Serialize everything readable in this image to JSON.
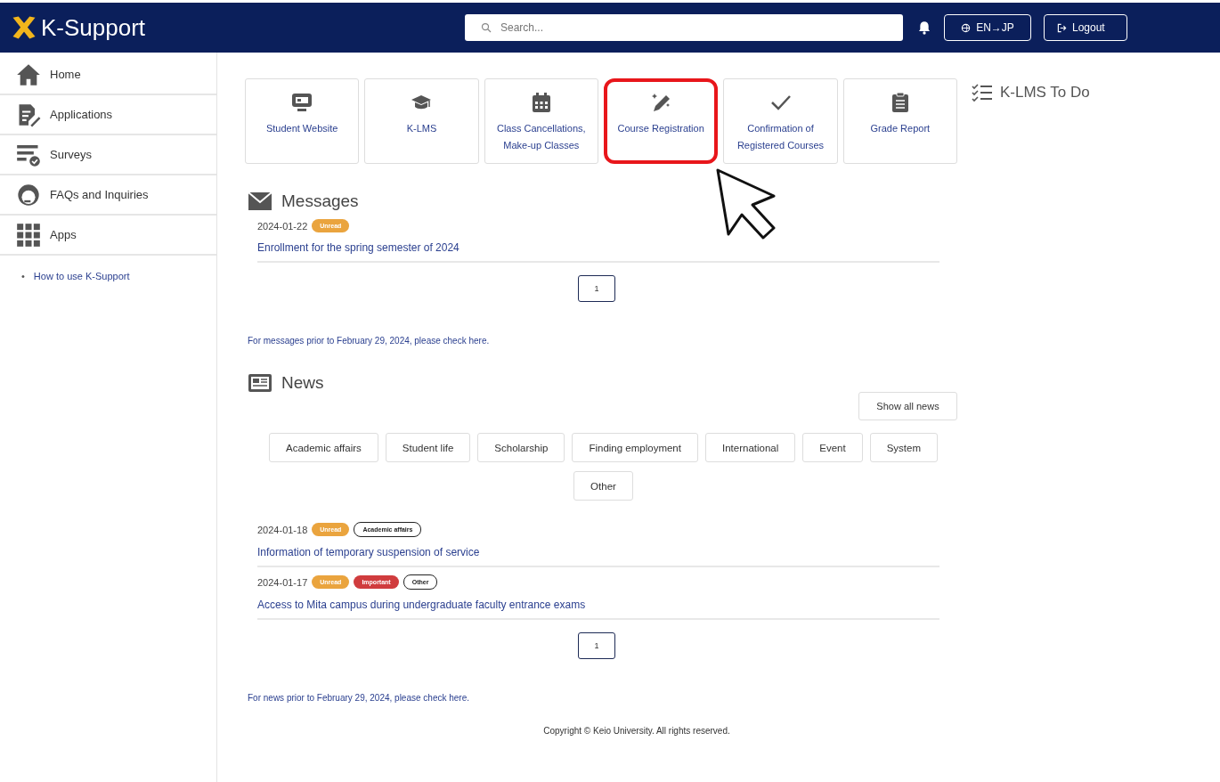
{
  "header": {
    "logo": "K-Support",
    "search": {
      "placeholder": "Search..."
    },
    "buttons": [
      {
        "kind": "language",
        "label": "EN→JP"
      },
      {
        "kind": "logout",
        "label": "Logout"
      }
    ]
  },
  "sidebar": {
    "items": [
      {
        "kind": "home",
        "label": "Home"
      },
      {
        "kind": "applications",
        "label": "Applications"
      },
      {
        "kind": "surveys",
        "label": "Surveys"
      },
      {
        "kind": "faq",
        "label": "FAQs and Inquiries"
      },
      {
        "kind": "apps",
        "label": "Apps"
      }
    ],
    "links": [
      {
        "bullet": "•",
        "label": "How to use K-Support"
      }
    ]
  },
  "shortcuts": [
    {
      "kind": "website",
      "label": "Student Website",
      "highlighted": false
    },
    {
      "kind": "lms",
      "label": "K-LMS",
      "highlighted": false
    },
    {
      "kind": "calendar",
      "label": "Class Cancellations, Make-up Classes",
      "highlighted": false
    },
    {
      "kind": "registration",
      "label": "Course Registration",
      "highlighted": true
    },
    {
      "kind": "confirm",
      "label": "Confirmation of Registered Courses",
      "highlighted": false
    },
    {
      "kind": "grades",
      "label": "Grade Report",
      "highlighted": false
    }
  ],
  "cursor": {
    "shown": true
  },
  "todo": {
    "title": "K-LMS To Do"
  },
  "messages": {
    "title": "Messages",
    "items": [
      {
        "date": "2024-01-22",
        "badges": [
          {
            "kind": "unread",
            "label": "Unread"
          }
        ],
        "title": "Enrollment for the spring semester of 2024"
      }
    ],
    "pages": [
      {
        "label": "1",
        "selected": true
      }
    ],
    "note": "For messages prior to February 29, 2024, please check here."
  },
  "news": {
    "title": "News",
    "show_all": "Show all news",
    "categories": [
      "Academic affairs",
      "Student life",
      "Scholarship",
      "Finding employment",
      "International",
      "Event",
      "System",
      "Other"
    ],
    "items": [
      {
        "date": "2024-01-18",
        "badges": [
          {
            "kind": "unread",
            "label": "Unread"
          },
          {
            "kind": "category",
            "label": "Academic affairs"
          }
        ],
        "title": "Information of temporary suspension of service"
      },
      {
        "date": "2024-01-17",
        "badges": [
          {
            "kind": "unread",
            "label": "Unread"
          },
          {
            "kind": "important",
            "label": "Important"
          },
          {
            "kind": "category",
            "label": "Other"
          }
        ],
        "title": "Access to Mita campus during undergraduate faculty entrance exams"
      }
    ],
    "pages": [
      {
        "label": "1",
        "selected": true
      }
    ],
    "note": "For news prior to February 29, 2024, please check here."
  },
  "footer": "Copyright © Keio University. All rights reserved."
}
